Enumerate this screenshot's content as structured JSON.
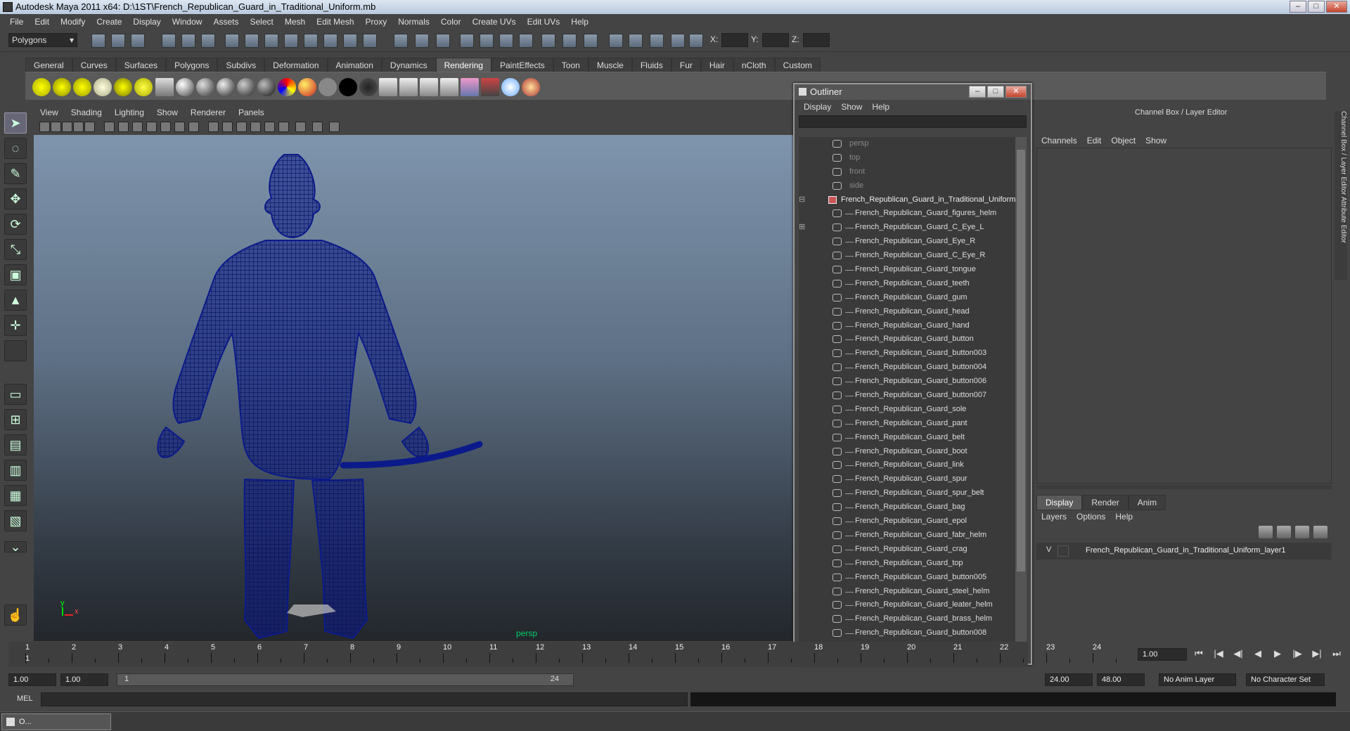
{
  "window": {
    "title": "Autodesk Maya 2011 x64: D:\\1ST\\French_Republican_Guard_in_Traditional_Uniform.mb",
    "minimize": "–",
    "maximize": "□",
    "close": "✕"
  },
  "menubar": [
    "File",
    "Edit",
    "Modify",
    "Create",
    "Display",
    "Window",
    "Assets",
    "Select",
    "Mesh",
    "Edit Mesh",
    "Proxy",
    "Normals",
    "Color",
    "Create UVs",
    "Edit UVs",
    "Help"
  ],
  "status_line": {
    "mode": "Polygons",
    "x_label": "X:",
    "y_label": "Y:",
    "z_label": "Z:"
  },
  "shelf_tabs": [
    "General",
    "Curves",
    "Surfaces",
    "Polygons",
    "Subdivs",
    "Deformation",
    "Animation",
    "Dynamics",
    "Rendering",
    "PaintEffects",
    "Toon",
    "Muscle",
    "Fluids",
    "Fur",
    "Hair",
    "nCloth",
    "Custom"
  ],
  "active_shelf": "Rendering",
  "panel_menu": [
    "View",
    "Shading",
    "Lighting",
    "Show",
    "Renderer",
    "Panels"
  ],
  "viewport": {
    "camera_label": "persp",
    "axis_y": "y",
    "axis_x": "x",
    "wire_color": "#0b1a8a"
  },
  "outliner": {
    "title": "Outliner",
    "menu": [
      "Display",
      "Show",
      "Help"
    ],
    "cameras": [
      "persp",
      "top",
      "front",
      "side"
    ],
    "root": "French_Republican_Guard_in_Traditional_Uniform",
    "items": [
      "French_Republican_Guard_figures_helm",
      "French_Republican_Guard_C_Eye_L",
      "French_Republican_Guard_Eye_R",
      "French_Republican_Guard_C_Eye_R",
      "French_Republican_Guard_tongue",
      "French_Republican_Guard_teeth",
      "French_Republican_Guard_gum",
      "French_Republican_Guard_head",
      "French_Republican_Guard_hand",
      "French_Republican_Guard_button",
      "French_Republican_Guard_button003",
      "French_Republican_Guard_button004",
      "French_Republican_Guard_button006",
      "French_Republican_Guard_button007",
      "French_Republican_Guard_sole",
      "French_Republican_Guard_pant",
      "French_Republican_Guard_belt",
      "French_Republican_Guard_boot",
      "French_Republican_Guard_link",
      "French_Republican_Guard_spur",
      "French_Republican_Guard_spur_belt",
      "French_Republican_Guard_bag",
      "French_Republican_Guard_epol",
      "French_Republican_Guard_fabr_helm",
      "French_Republican_Guard_crag",
      "French_Republican_Guard_top",
      "French_Republican_Guard_button005",
      "French_Republican_Guard_steel_helm",
      "French_Republican_Guard_leater_helm",
      "French_Republican_Guard_brass_helm",
      "French_Republican_Guard_button008"
    ]
  },
  "channel_box": {
    "title": "Channel Box / Layer Editor",
    "menu": [
      "Channels",
      "Edit",
      "Object",
      "Show"
    ]
  },
  "side_tabs": "Channel Box / Layer Editor    Attribute Editor",
  "layer_editor": {
    "tabs": [
      "Display",
      "Render",
      "Anim"
    ],
    "active_tab": "Display",
    "menu": [
      "Layers",
      "Options",
      "Help"
    ],
    "layer": {
      "visible": "V",
      "name": "French_Republican_Guard_in_Traditional_Uniform_layer1"
    }
  },
  "time_slider": {
    "ticks": [
      "1",
      "2",
      "3",
      "4",
      "5",
      "6",
      "7",
      "8",
      "9",
      "10",
      "11",
      "12",
      "13",
      "14",
      "15",
      "16",
      "17",
      "18",
      "19",
      "20",
      "21",
      "22",
      "23",
      "24"
    ],
    "current_frame": "1",
    "current_time": "1.00"
  },
  "playback": [
    "⏮",
    "|◀",
    "◀|",
    "◀",
    "▶",
    "|▶",
    "▶|",
    "⏭"
  ],
  "range_slider": {
    "start": "1.00",
    "start2": "1.00",
    "bar_start": "1",
    "bar_end": "24",
    "end": "24.00",
    "end2": "48.00",
    "anim_layer": "No Anim Layer",
    "char_set": "No Character Set"
  },
  "command_line": {
    "label": "MEL"
  },
  "taskbar": {
    "label": "O..."
  }
}
